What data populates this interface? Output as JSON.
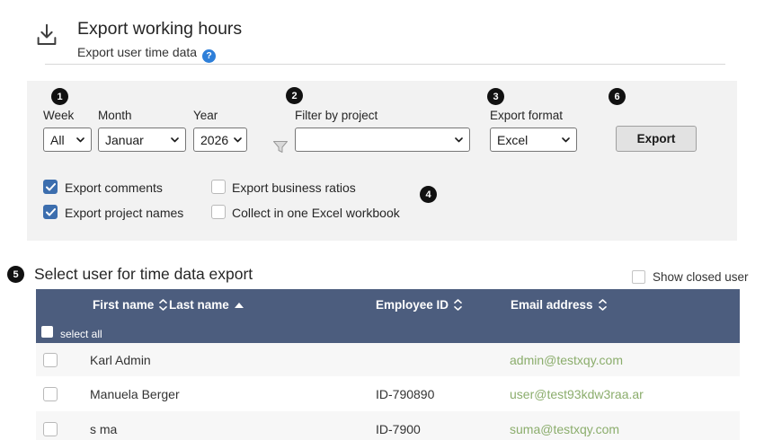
{
  "header": {
    "title": "Export working hours",
    "subtitle": "Export user time data"
  },
  "filters": {
    "badges": {
      "period": "1",
      "project": "2",
      "format": "3",
      "options": "4",
      "users": "5",
      "export": "6"
    },
    "week": {
      "label": "Week",
      "value": "All"
    },
    "month": {
      "label": "Month",
      "value": "Januar"
    },
    "year": {
      "label": "Year",
      "value": "2026"
    },
    "project": {
      "label": "Filter by project",
      "value": ""
    },
    "format": {
      "label": "Export format",
      "value": "Excel"
    },
    "export_button_label": "Export",
    "checkboxes": [
      {
        "label": "Export comments",
        "checked": true
      },
      {
        "label": "Export project names",
        "checked": true
      },
      {
        "label": "Export business ratios",
        "checked": false
      },
      {
        "label": "Collect in one Excel workbook",
        "checked": false
      }
    ]
  },
  "user_section": {
    "heading": "Select user for time data export",
    "show_closed_label": "Show closed user",
    "show_closed_checked": false,
    "table": {
      "columns": [
        "First name",
        "Last name",
        "Employee ID",
        "Email address"
      ],
      "sort": {
        "active_column": "Last name",
        "direction": "asc"
      },
      "select_all_label": "select all",
      "select_all_checked": false,
      "rows": [
        {
          "first_name": "Karl",
          "last_name": "Admin",
          "employee_id": "",
          "email": "admin@testxqy.com",
          "checked": false
        },
        {
          "first_name": "Manuela",
          "last_name": "Berger",
          "employee_id": "ID-790890",
          "email": "user@test93kdw3raa.ar",
          "checked": false
        },
        {
          "first_name": "s",
          "last_name": "ma",
          "employee_id": "ID-7900",
          "email": "suma@testxqy.com",
          "checked": false
        }
      ]
    }
  },
  "colors": {
    "table_header": "#4c5d7e",
    "email_link": "#8bad6c",
    "checkbox_checked": "#3c6eae",
    "help_icon": "#2e7fd9",
    "badge": "#111111",
    "panel_background": "#f2f2f2"
  }
}
